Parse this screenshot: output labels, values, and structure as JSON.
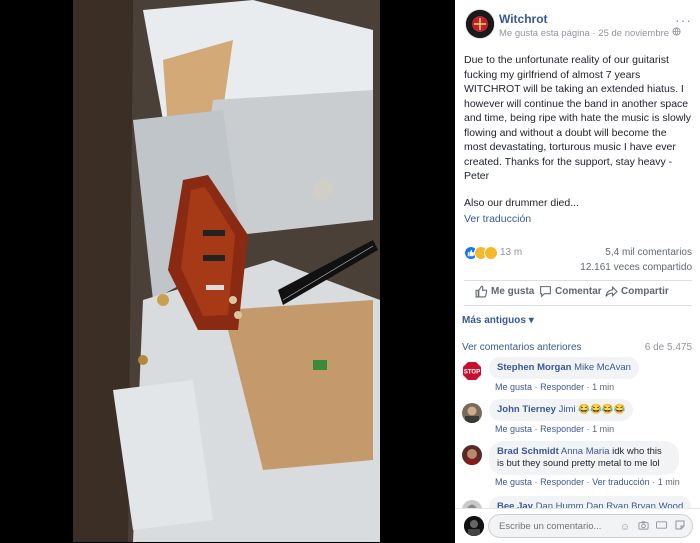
{
  "page": {
    "name": "Witchrot",
    "like_label": "Me gusta esta página",
    "separator": "·",
    "date": "25 de noviembre",
    "more_symbol": "···"
  },
  "post": {
    "paragraph1": "Due to the unfortunate reality of our guitarist fucking my girlfriend of almost 7 years WITCHROT will be taking an extended hiatus. I however will continue the band in another space and time, being ripe with hate the music is slowly flowing and without a doubt will become the most devastating, torturous music I have ever created. Thanks for the support, stay heavy - Peter",
    "paragraph2": "Also our drummer died...",
    "see_translation": "Ver traducción"
  },
  "stats": {
    "reactions": "13 m",
    "comments": "5,4 mil comentarios",
    "shares": "12.161 veces compartido"
  },
  "actions": {
    "like": "Me gusta",
    "comment": "Comentar",
    "share": "Compartir"
  },
  "comments": {
    "older_label": "Más antiguos",
    "older_chevron": "▾",
    "view_previous": "Ver comentarios anteriores",
    "count": "6 de 5.475",
    "items": [
      {
        "name": "Stephen Morgan",
        "tag": "Mike McAvan",
        "text": "",
        "like": "Me gusta",
        "reply": "Responder",
        "time": "1 min",
        "avatar": "STOP"
      },
      {
        "name": "John Tierney",
        "tag": "Jimi",
        "text": "😂😂😂😂",
        "like": "Me gusta",
        "reply": "Responder",
        "time": "1 min"
      },
      {
        "name": "Brad Schmidt",
        "tag": "Anna Maria",
        "text": "idk who this is but they sound pretty metal to me lol",
        "like": "Me gusta",
        "reply": "Responder",
        "translate": "Ver traducción",
        "time": "1 min"
      },
      {
        "name": "Bee Jay",
        "tag": "Dan Humm Dan Ryan Bryan Wood",
        "text": ""
      }
    ],
    "dot": "·"
  },
  "composer": {
    "placeholder": "Escribe un comentario..."
  },
  "colors": {
    "link": "#385898",
    "like_blue": "#1877f2",
    "bubble": "#f2f3f5"
  }
}
